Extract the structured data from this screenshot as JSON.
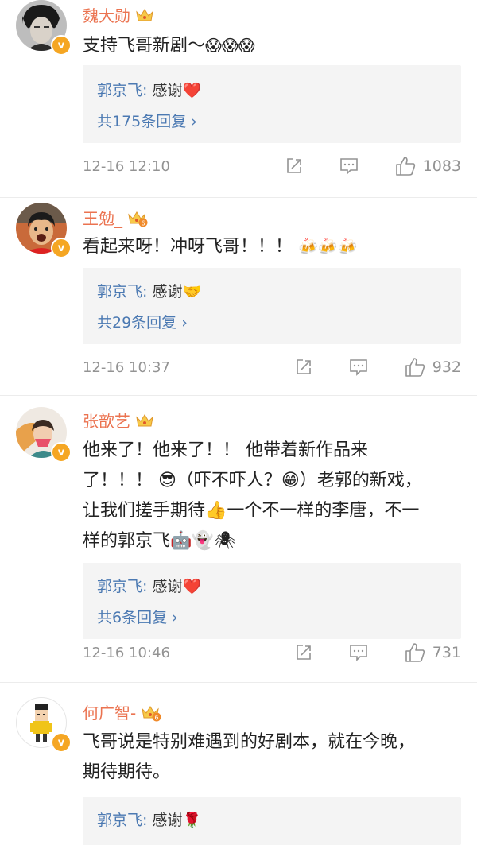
{
  "comments": [
    {
      "username": "魏大勋",
      "text": "支持飞哥新剧～",
      "emojis": "😱😱😱",
      "reply": {
        "author": "郭京飞:",
        "text": " 感谢",
        "emoji": "❤️"
      },
      "reply_count": "共175条回复 ›",
      "time": "12-16 12:10",
      "likes": "1083"
    },
    {
      "username": "王勉_",
      "text": "看起来呀！冲呀飞哥！！！",
      "emojis": "🍻🍻🍻",
      "reply": {
        "author": "郭京飞:",
        "text": " 感谢",
        "emoji": "🤝"
      },
      "reply_count": "共29条回复 ›",
      "time": "12-16 10:37",
      "likes": "932"
    },
    {
      "username": "张歆艺",
      "text_lines": [
        "他来了！他来了！！ 他带着新作品来",
        "了！！！ 😎（吓不吓人？😁）老郭的新戏，",
        "让我们搓手期待👍一个不一样的李唐，不一",
        "样的郭京飞🤖👻🕷"
      ],
      "reply": {
        "author": "郭京飞:",
        "text": " 感谢",
        "emoji": "❤️"
      },
      "reply_count": "共6条回复 ›",
      "time": "12-16 10:46",
      "likes": "731"
    },
    {
      "username": "何广智-",
      "text_lines": [
        "飞哥说是特别难遇到的好剧本，就在今晚，",
        "期待期待。"
      ],
      "reply": {
        "author": "郭京飞:",
        "text": " 感谢",
        "emoji": "🌹"
      }
    }
  ],
  "colors": {
    "username": "#eb7350",
    "link": "#4b79b2",
    "meta": "#939393",
    "reply_bg": "#f4f4f4",
    "vip_badge": "#f5a623"
  },
  "icons": {
    "verified": "v-badge-icon",
    "member": "crown-icon",
    "share": "share-icon",
    "comment": "comment-icon",
    "like": "thumbs-up-icon"
  },
  "badges": {
    "verified": "v",
    "level6": "6"
  }
}
